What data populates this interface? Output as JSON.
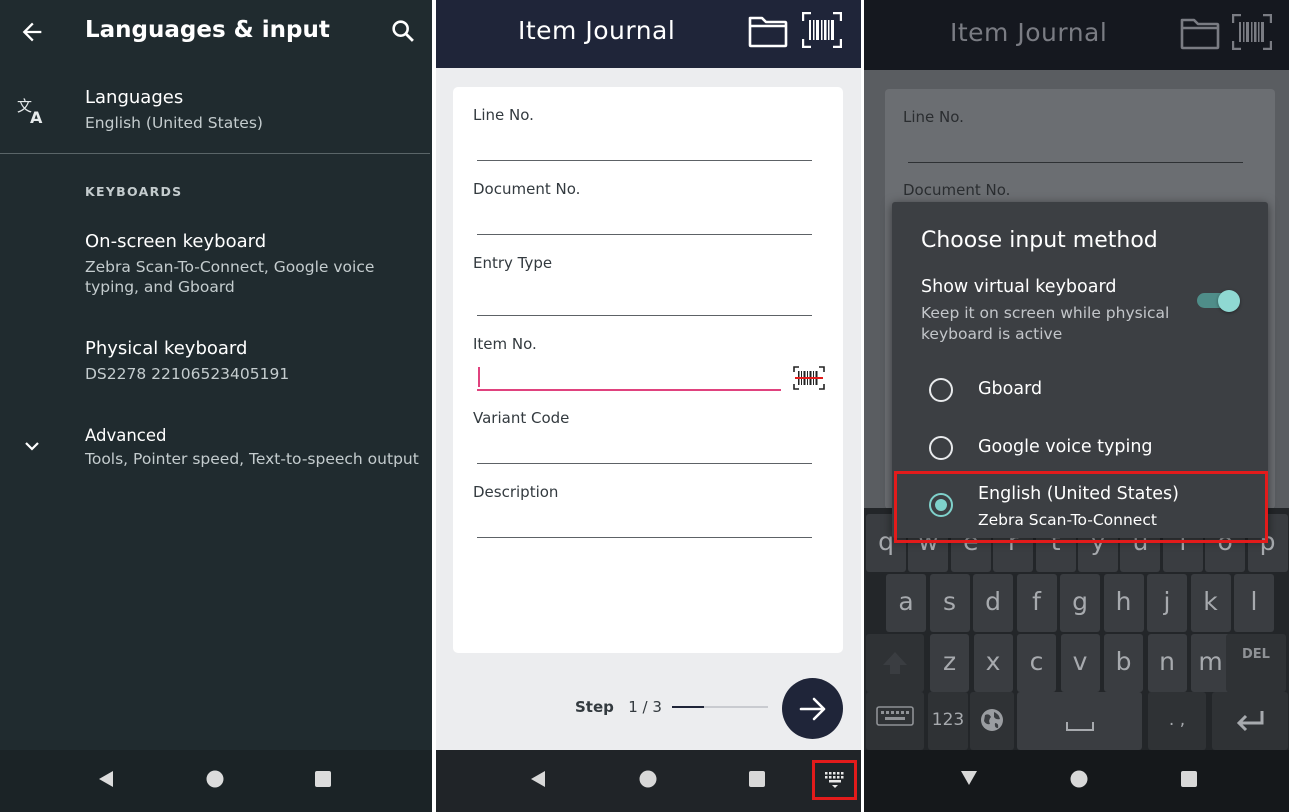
{
  "settings": {
    "title": "Languages & input",
    "languages": {
      "title": "Languages",
      "subtitle": "English (United States)"
    },
    "keyboards_section": "KEYBOARDS",
    "onscreen": {
      "title": "On-screen keyboard",
      "subtitle": "Zebra Scan-To-Connect, Google voice typing, and Gboard"
    },
    "physical": {
      "title": "Physical keyboard",
      "subtitle": "DS2278 22106523405191"
    },
    "advanced": {
      "title": "Advanced",
      "subtitle": "Tools, Pointer speed, Text-to-speech output"
    }
  },
  "journal": {
    "title": "Item Journal",
    "fields": [
      {
        "label": "Line No."
      },
      {
        "label": "Document No."
      },
      {
        "label": "Entry Type"
      },
      {
        "label": "Item No."
      },
      {
        "label": "Variant Code"
      },
      {
        "label": "Description"
      }
    ],
    "step_label": "Step",
    "step_current": "1",
    "step_sep": "/",
    "step_total": "3",
    "step_progress": 0.33
  },
  "dialog": {
    "title": "Choose input method",
    "show_virtual_keyboard": "Show virtual keyboard",
    "show_virtual_keyboard_desc": "Keep it on screen while physical keyboard is active",
    "toggle_on": true,
    "options": [
      {
        "label": "Gboard",
        "selected": false
      },
      {
        "label": "Google voice typing",
        "selected": false
      },
      {
        "label": "English (United States)",
        "sublabel": "Zebra Scan-To-Connect",
        "selected": true
      }
    ]
  },
  "keyboard": {
    "row1": [
      "q",
      "w",
      "e",
      "r",
      "t",
      "y",
      "u",
      "i",
      "o",
      "p"
    ],
    "row2": [
      "a",
      "s",
      "d",
      "f",
      "g",
      "h",
      "j",
      "k",
      "l"
    ],
    "row3": [
      "z",
      "x",
      "c",
      "v",
      "b",
      "n",
      "m"
    ],
    "del_label": "DEL",
    "num_label": "123",
    "punct_label": ". ,"
  },
  "colors": {
    "accent_pink": "#e0427e",
    "accent_teal": "#7fd1cb",
    "header_navy": "#1f2539",
    "highlight_red": "#e31b1b"
  },
  "icons": {
    "back": "arrow-left-icon",
    "search": "search-icon",
    "translate": "translate-icon",
    "expand": "chevron-down-icon",
    "folder": "folder-icon",
    "barcode": "barcode-scan-icon",
    "next": "arrow-right-icon",
    "keyboard": "keyboard-icon"
  }
}
